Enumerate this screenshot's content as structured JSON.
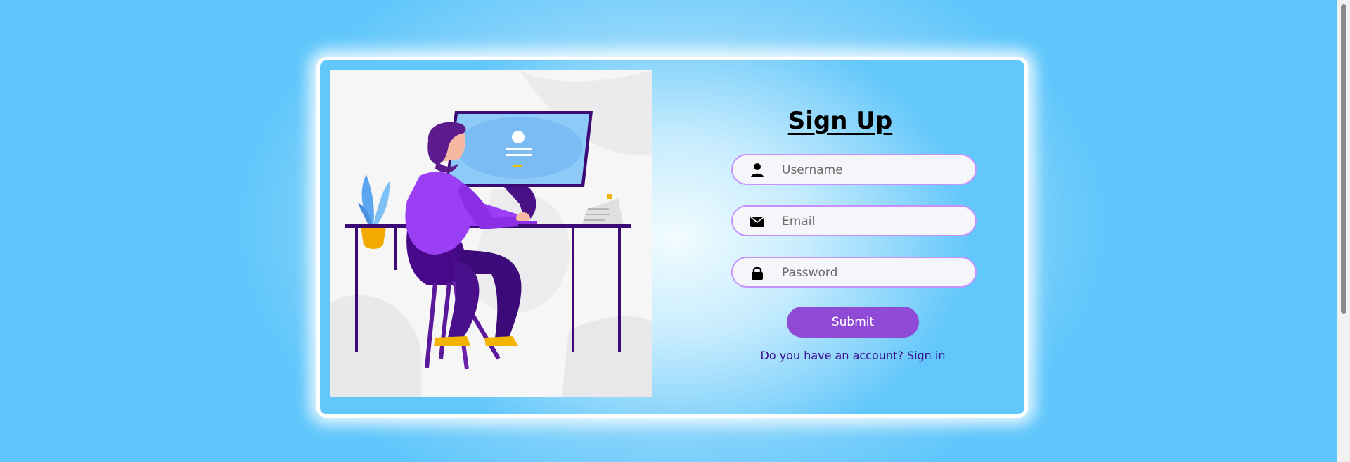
{
  "form": {
    "title": "Sign Up",
    "username": {
      "placeholder": "Username",
      "value": "",
      "icon": "user-icon"
    },
    "email": {
      "placeholder": "Email",
      "value": "",
      "icon": "envelope-icon"
    },
    "password": {
      "placeholder": "Password",
      "value": "",
      "icon": "lock-icon"
    },
    "submit_label": "Submit",
    "account_prompt": "Do you have an account?",
    "signin_link": "Sign in"
  },
  "colors": {
    "accent": "#8f4ad6",
    "field_border": "#c690ff",
    "link": "#3a0c8e",
    "background": "#5fc6fb"
  }
}
